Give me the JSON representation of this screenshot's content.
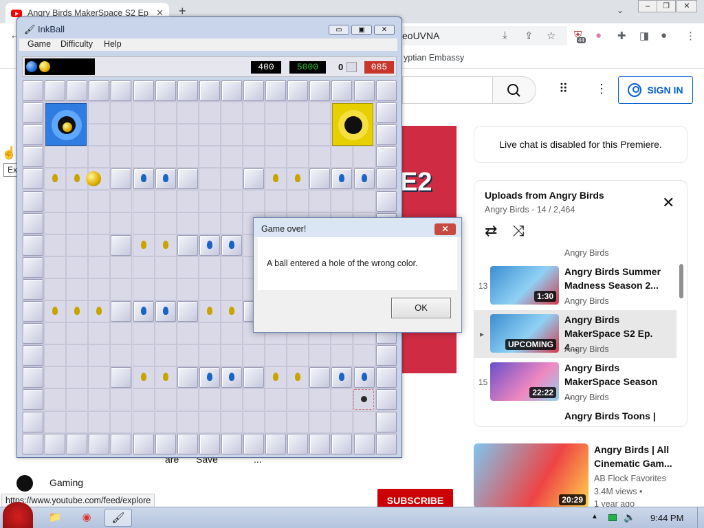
{
  "browser": {
    "tab_title": "Angry Birds MakerSpace S2 Ep",
    "tab_close": "✕",
    "new_tab": "+",
    "omnibox_text": "eoUVNA",
    "bookmark_text": "yptian Embassy",
    "extension_badge": "44"
  },
  "youtube": {
    "sign_in": "SIGN IN",
    "live_chat": "Live chat is disabled for this Premiere.",
    "video_overlay": "E2",
    "playlist": {
      "title": "Uploads from Angry Birds",
      "subtitle": "Angry Birds - 14 / 2,464",
      "top_channel": "Angry Birds",
      "items": [
        {
          "num": "13",
          "title": "Angry Birds Summer Madness Season 2...",
          "channel": "Angry Birds",
          "duration": "1:30"
        },
        {
          "num": "▸",
          "title": "Angry Birds MakerSpace S2 Ep. 4...",
          "channel": "Angry Birds",
          "duration": "UPCOMING"
        },
        {
          "num": "15",
          "title": "Angry Birds MakerSpace Season ...",
          "channel": "Angry Birds",
          "duration": "22:22"
        },
        {
          "num": "",
          "title": "Angry Birds Toons |",
          "channel": "",
          "duration": ""
        }
      ]
    },
    "recommended": {
      "title": "Angry Birds | All Cinematic Gam...",
      "channel": "AB Flock Favorites",
      "views": "3.4M views •",
      "age": "1 year ago",
      "duration": "20:29"
    },
    "subscribe": "SUBSCRIBE",
    "share": "are",
    "save": "Save",
    "more": "...",
    "gaming": "Gaming",
    "tooltip": "Explore",
    "status_url": "https://www.youtube.com/feed/explore"
  },
  "inkball": {
    "title": "InkBall",
    "menu": [
      "Game",
      "Difficulty",
      "Help"
    ],
    "score": "400",
    "high_score": "5000",
    "balls_count": "0",
    "timer": "085",
    "colors": {
      "blue": "#1f6fd8",
      "yellow": "#e6c600",
      "timer_red": "#c8352b",
      "score_green": "#28c228"
    }
  },
  "dialog": {
    "title": "Game over!",
    "message": "A ball entered a hole of the wrong color.",
    "ok": "OK",
    "close": "✕"
  },
  "taskbar": {
    "clock": "9:44 PM"
  }
}
